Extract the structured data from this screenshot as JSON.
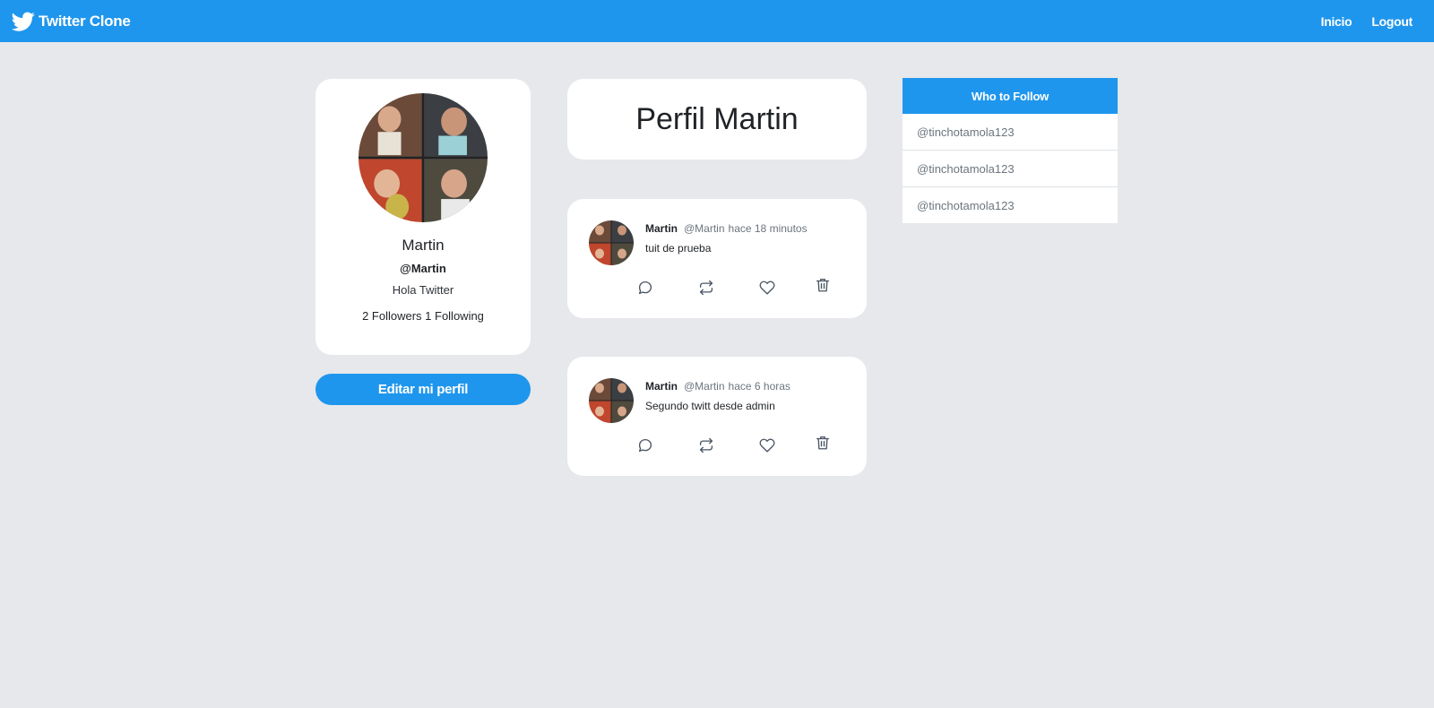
{
  "navbar": {
    "brand": "Twitter Clone",
    "links": [
      "Inicio",
      "Logout"
    ]
  },
  "profile": {
    "name": "Martin",
    "handle": "@Martin",
    "bio": "Hola Twitter",
    "stats": "2 Followers 1 Following",
    "edit_button": "Editar mi perfil"
  },
  "main": {
    "title": "Perfil Martin",
    "tweets": [
      {
        "author": "Martin",
        "handle": "@Martin",
        "time": "hace 18 minutos",
        "text": "tuit de prueba"
      },
      {
        "author": "Martin",
        "handle": "@Martin",
        "time": "hace 6 horas",
        "text": "Segundo twitt desde admin"
      }
    ]
  },
  "who_to_follow": {
    "title": "Who to Follow",
    "users": [
      "@tinchotamola123",
      "@tinchotamola123",
      "@tinchotamola123"
    ]
  },
  "icons": {
    "brand": "twitter-bird-icon",
    "reply": "comment-icon",
    "retweet": "retweet-icon",
    "like": "heart-icon",
    "delete": "trash-icon"
  },
  "colors": {
    "accent": "#1f96ed",
    "background": "#e6e8eb",
    "card": "#ffffff"
  }
}
